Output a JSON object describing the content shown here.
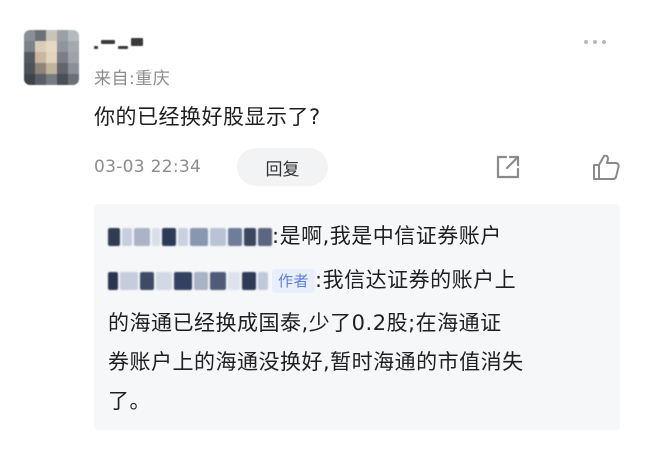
{
  "comment": {
    "location": "来自:重庆",
    "text": "你的已经换好股显示了?",
    "time": "03-03 22:34",
    "reply_label": "回复"
  },
  "reply": {
    "line1": ":是啊,我是中信证券账户",
    "author_tag": "作者",
    "line2_tail": ":我信达证券的账户上",
    "line3": "的海通已经换成国泰,少了0.2股;在海通证",
    "line4": "券账户上的海通没换好,暂时海通的市值消失",
    "line5": "了。"
  },
  "icons": {
    "more": "more-icon",
    "share": "share-icon",
    "like": "thumbs-up-icon"
  },
  "colors": {
    "reply_background": "#f6f7f9",
    "author_tag_text": "#5b7fd6",
    "author_tag_background": "#e8eefc",
    "secondary_text": "#8c8c8c"
  }
}
